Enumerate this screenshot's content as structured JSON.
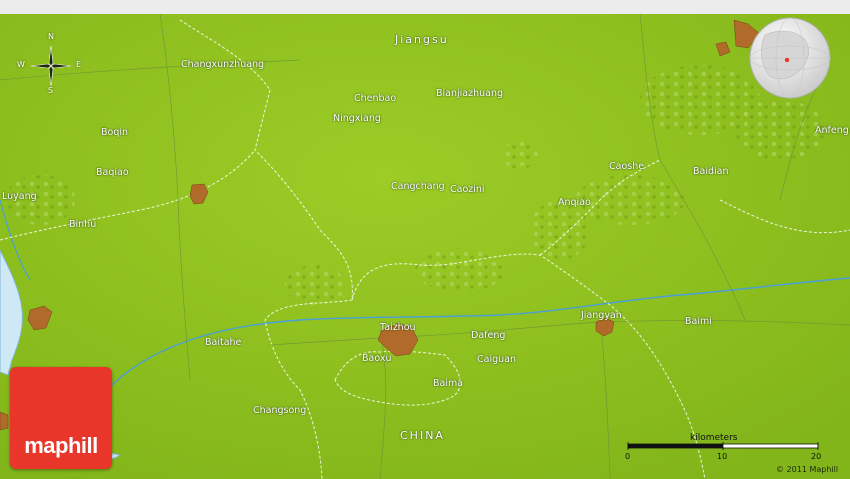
{
  "map": {
    "region_label": "Jiangsu",
    "country_label": "CHINA",
    "places": [
      {
        "name": "Changxunzhuang"
      },
      {
        "name": "Chenbao"
      },
      {
        "name": "Bianjiazhuang"
      },
      {
        "name": "Ningxiang"
      },
      {
        "name": "Boqin"
      },
      {
        "name": "Baqiao"
      },
      {
        "name": "Luyang"
      },
      {
        "name": "Binhu"
      },
      {
        "name": "Cangchang"
      },
      {
        "name": "Caozini"
      },
      {
        "name": "Caoshe"
      },
      {
        "name": "Baidian"
      },
      {
        "name": "Anfeng"
      },
      {
        "name": "Anqiao"
      },
      {
        "name": "Jiangyan"
      },
      {
        "name": "Baimi"
      },
      {
        "name": "Taizhou"
      },
      {
        "name": "Dafeng"
      },
      {
        "name": "Baitahe"
      },
      {
        "name": "Baoxu"
      },
      {
        "name": "Caiguan"
      },
      {
        "name": "Baima"
      },
      {
        "name": "Changsong"
      }
    ]
  },
  "compass": {
    "n": "N",
    "s": "S",
    "e": "E",
    "w": "W"
  },
  "scale": {
    "unit_label": "kilometers",
    "ticks": [
      "0",
      "10",
      "20"
    ]
  },
  "brand": {
    "logo_text": "maphill"
  },
  "copyright": "© 2011 Maphill",
  "colors": {
    "terrain": "#8fc21f",
    "urban": "#b06a2a",
    "water": "#cfe8f5",
    "river": "#4a9fd8",
    "logo": "#e8372a"
  }
}
